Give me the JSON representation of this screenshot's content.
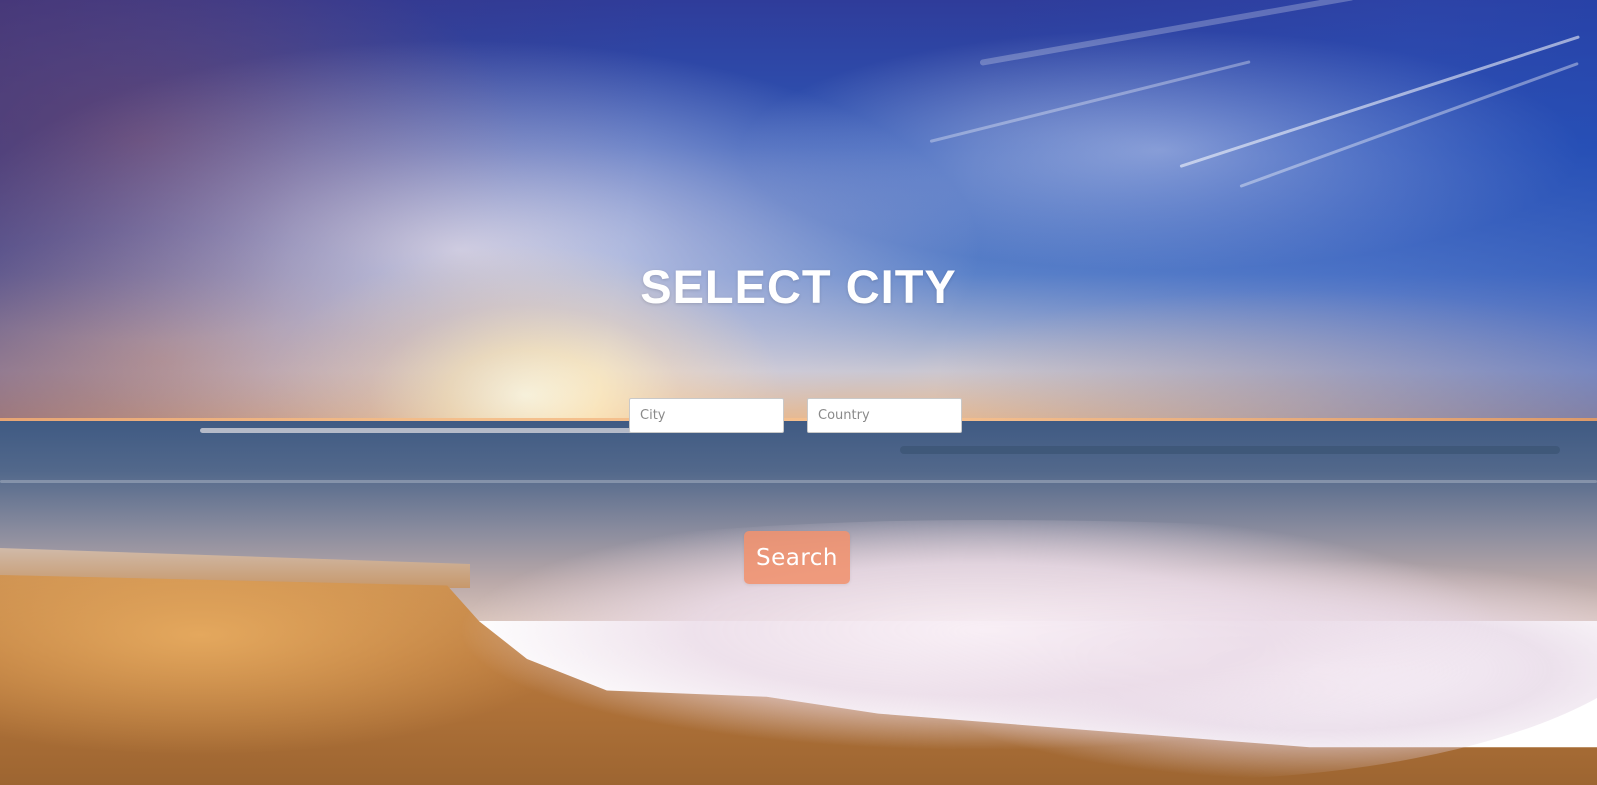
{
  "page": {
    "title": "SELECT CITY"
  },
  "form": {
    "city": {
      "value": "",
      "placeholder": "City"
    },
    "country": {
      "value": "",
      "placeholder": "Country"
    },
    "search_label": "Search"
  },
  "colors": {
    "button": "#f0926e",
    "title": "#ffffff",
    "input_bg": "#ffffff"
  }
}
